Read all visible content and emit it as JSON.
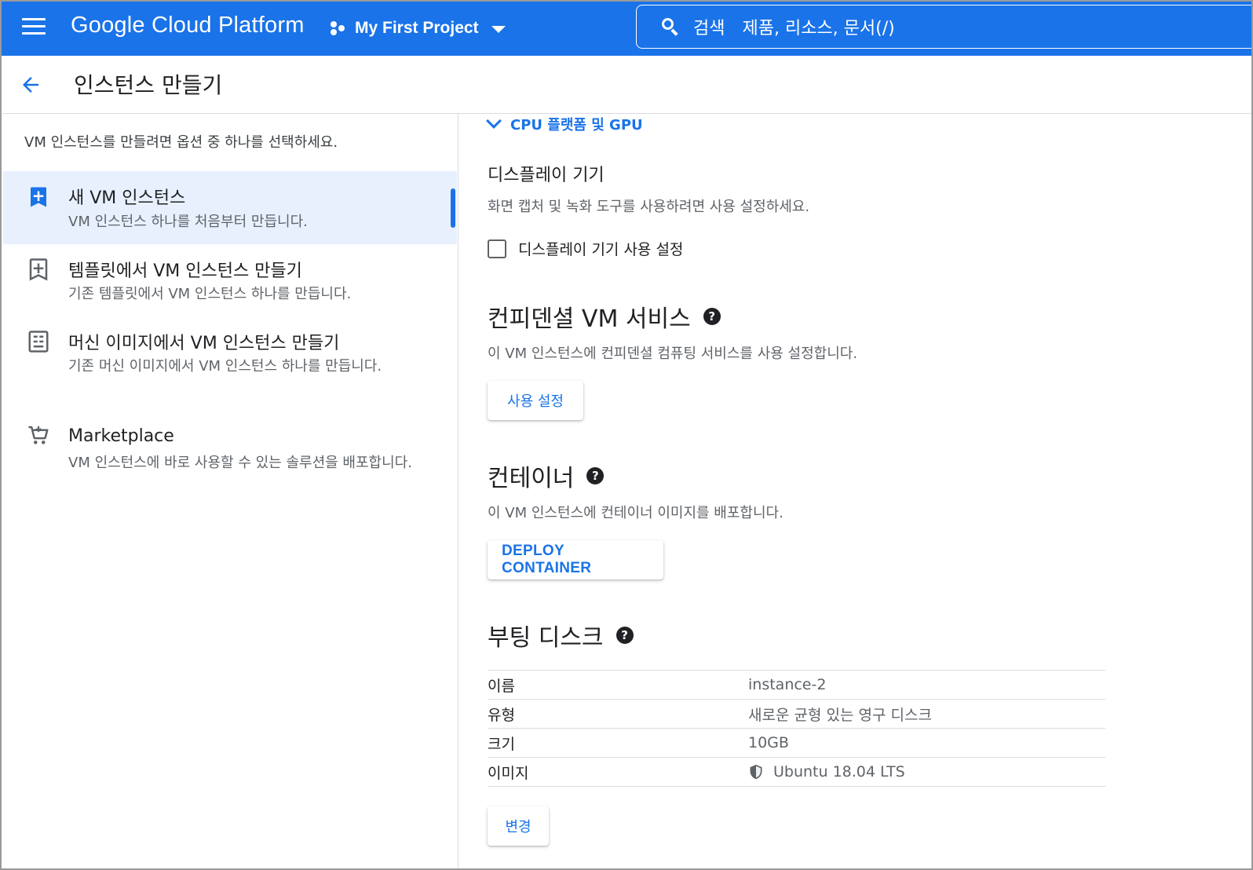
{
  "topbar": {
    "brand": "Google Cloud Platform",
    "project": "My First Project",
    "search_label": "검색",
    "search_placeholder": "제품, 리소스, 문서(/)",
    "accent_color": "#1a73e8"
  },
  "header": {
    "title": "인스턴스 만들기"
  },
  "left": {
    "intro": "VM 인스턴스를 만들려면 옵션 중 하나를 선택하세요.",
    "options": [
      {
        "title": "새 VM 인스턴스",
        "desc": "VM 인스턴스 하나를 처음부터 만듭니다.",
        "icon": "add-box-icon",
        "selected": true
      },
      {
        "title": "템플릿에서 VM 인스턴스 만들기",
        "desc": "기존 템플릿에서 VM 인스턴스 하나를 만듭니다.",
        "icon": "template-add-icon",
        "selected": false
      },
      {
        "title": "머신 이미지에서 VM 인스턴스 만들기",
        "desc": "기존 머신 이미지에서 VM 인스턴스 하나를 만듭니다.",
        "icon": "machine-image-icon",
        "selected": false
      },
      {
        "title": "Marketplace",
        "desc": "VM 인스턴스에 바로 사용할 수 있는 솔루션을 배포합니다.",
        "icon": "cart-icon",
        "selected": false
      }
    ]
  },
  "main": {
    "accordion_label": "CPU 플랫폼 및 GPU",
    "display": {
      "title": "디스플레이 기기",
      "desc": "화면 캡처 및 녹화 도구를 사용하려면 사용 설정하세요.",
      "checkbox_label": "디스플레이 기기 사용 설정",
      "checked": false
    },
    "confidential": {
      "title": "컨피덴셜 VM 서비스",
      "desc": "이 VM 인스턴스에 컨피덴셜 컴퓨팅 서비스를 사용 설정합니다.",
      "button": "사용 설정"
    },
    "container": {
      "title": "컨테이너",
      "desc": "이 VM 인스턴스에 컨테이너 이미지를 배포합니다.",
      "button": "DEPLOY CONTAINER"
    },
    "boot_disk": {
      "title": "부팅 디스크",
      "rows": [
        {
          "key": "이름",
          "value": "instance-2"
        },
        {
          "key": "유형",
          "value": "새로운 균형 있는 영구 디스크"
        },
        {
          "key": "크기",
          "value": "10GB"
        },
        {
          "key": "이미지",
          "value": "Ubuntu 18.04 LTS",
          "icon": "shield-icon"
        }
      ],
      "button": "변경"
    },
    "help_glyph": "?"
  }
}
